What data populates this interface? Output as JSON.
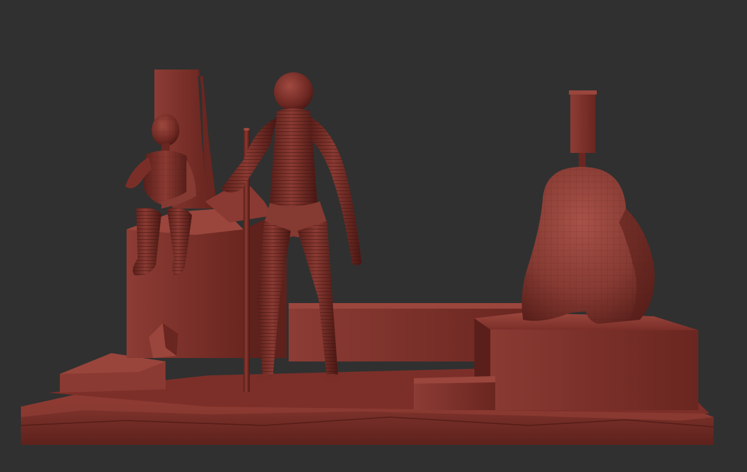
{
  "viewport": {
    "background_color": "#303030"
  },
  "materials": {
    "clay_base": "#7a2e28",
    "clay_light": "#9a463d",
    "clay_mid": "#6a2620",
    "clay_dark": "#4a1713",
    "clay_shadow": "#3a110e"
  },
  "scene_objects": [
    {
      "name": "ground-base",
      "type": "terrain-slab"
    },
    {
      "name": "back-wall",
      "type": "block"
    },
    {
      "name": "left-pillar",
      "type": "block"
    },
    {
      "name": "chimney",
      "type": "block"
    },
    {
      "name": "seated-figure",
      "type": "figure"
    },
    {
      "name": "standing-figure",
      "type": "figure"
    },
    {
      "name": "walking-staff",
      "type": "prop"
    },
    {
      "name": "raised-platform",
      "type": "block"
    },
    {
      "name": "creature-sculpture",
      "type": "figure"
    },
    {
      "name": "small-step",
      "type": "block"
    },
    {
      "name": "crystal-rock",
      "type": "prop"
    }
  ]
}
